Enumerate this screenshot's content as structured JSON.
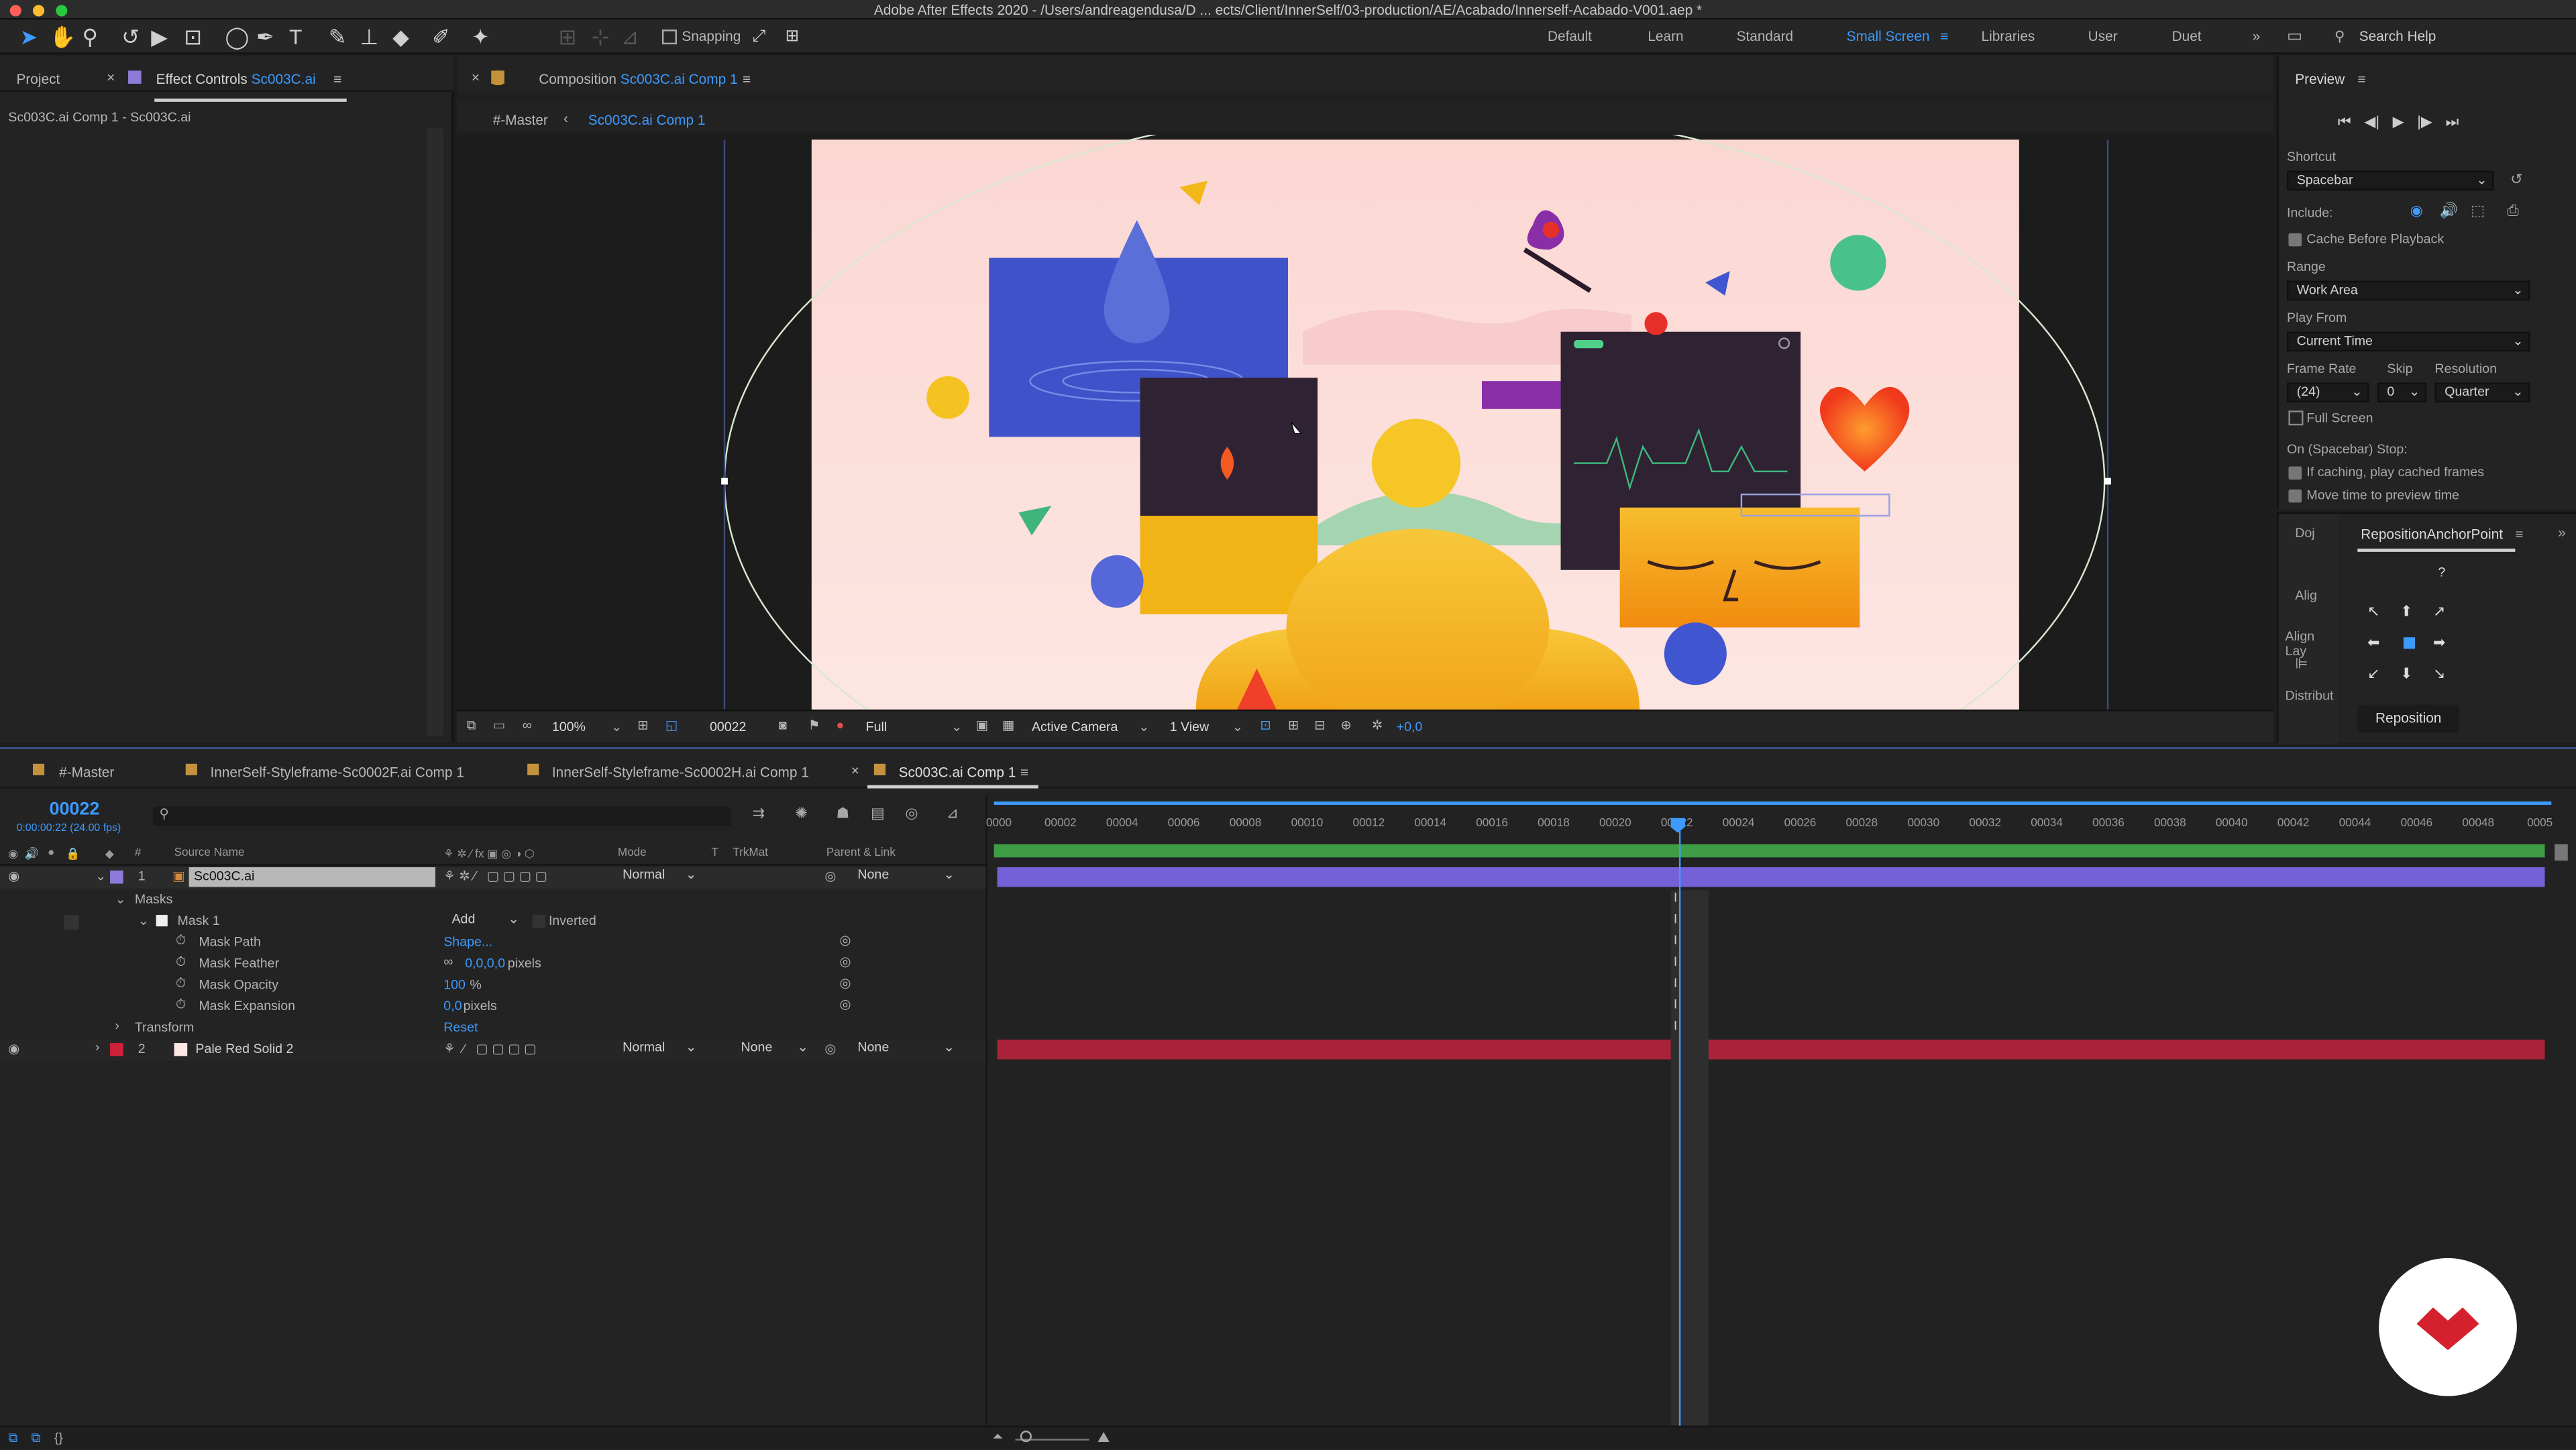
{
  "app": {
    "title": "Adobe After Effects 2020 - /Users/andreagendusa/D ... ects/Client/InnerSelf/03-production/AE/Acabado/Innerself-Acabado-V001.aep *"
  },
  "toolbar": {
    "snapping": "Snapping",
    "workspaces": [
      "Default",
      "Learn",
      "Standard",
      "Small Screen",
      "Libraries",
      "User",
      "Duet"
    ],
    "active_workspace": "Small Screen",
    "search_placeholder": "Search Help"
  },
  "left_panel": {
    "tab_project": "Project",
    "tab_effect_controls": "Effect Controls",
    "effect_target": "Sc003C.ai",
    "subtitle": "Sc003C.ai Comp 1 - Sc003C.ai"
  },
  "composition": {
    "tab_prefix": "Composition",
    "comp_name": "Sc003C.ai Comp 1",
    "breadcrumb_master": "#-Master",
    "breadcrumb_comp": "Sc003C.ai Comp 1",
    "zoom": "100%",
    "timecode": "00022",
    "resolution": "Full",
    "camera": "Active Camera",
    "views": "1 View",
    "exposure": "+0,0"
  },
  "preview": {
    "title": "Preview",
    "shortcut_label": "Shortcut",
    "shortcut_value": "Spacebar",
    "include_label": "Include:",
    "cache_label": "Cache Before Playback",
    "range_label": "Range",
    "range_value": "Work Area",
    "play_from_label": "Play From",
    "play_from_value": "Current Time",
    "frame_rate_label": "Frame Rate",
    "skip_label": "Skip",
    "resolution_label": "Resolution",
    "frame_rate_value": "(24)",
    "skip_value": "0",
    "resolution_value": "Quarter",
    "full_screen": "Full Screen",
    "on_stop_label": "On (Spacebar) Stop:",
    "if_caching": "If caching, play cached frames",
    "move_time": "Move time to preview time"
  },
  "reposition": {
    "tab_doj": "Doj",
    "tab_name": "RepositionAnchorPoint",
    "align_tab": "Alig",
    "align_layers": "Align Lay",
    "distribute": "Distribut",
    "help": "?",
    "button": "Reposition"
  },
  "timeline": {
    "tabs": [
      "#-Master",
      "InnerSelf-Styleframe-Sc0002F.ai Comp 1",
      "InnerSelf-Styleframe-Sc0002H.ai Comp 1",
      "Sc003C.ai Comp 1"
    ],
    "active_tab": "Sc003C.ai Comp 1",
    "timecode": "00022",
    "timecode_sub": "0:00:00:22 (24.00 fps)",
    "col_source_name": "Source Name",
    "col_mode": "Mode",
    "col_t": "T",
    "col_trkmat": "TrkMat",
    "col_parent": "Parent & Link",
    "ruler": [
      "0000",
      "00002",
      "00004",
      "00006",
      "00008",
      "00010",
      "00012",
      "00014",
      "00016",
      "00018",
      "00020",
      "00022",
      "00024",
      "00026",
      "00028",
      "00030",
      "00032",
      "00034",
      "00036",
      "00038",
      "00040",
      "00042",
      "00044",
      "00046",
      "00048",
      "0005"
    ],
    "layer1": {
      "num": "1",
      "name": "Sc003C.ai",
      "mode": "Normal",
      "parent": "None",
      "color": "#7b6ad6"
    },
    "masks_label": "Masks",
    "mask1": {
      "name": "Mask 1",
      "mode": "Add",
      "inverted": "Inverted"
    },
    "mask_props": [
      {
        "name": "Mask Path",
        "value": "Shape..."
      },
      {
        "name": "Mask Feather",
        "value": "0,0,0,0",
        "unit": " pixels"
      },
      {
        "name": "Mask Opacity",
        "value": "100",
        "unit": "%"
      },
      {
        "name": "Mask Expansion",
        "value": "0,0",
        "unit": " pixels"
      }
    ],
    "transform_label": "Transform",
    "transform_reset": "Reset",
    "layer2": {
      "num": "2",
      "name": "Pale Red Solid 2",
      "mode": "Normal",
      "trkmat": "None",
      "parent": "None",
      "color": "#d0213a"
    },
    "playhead_fraction": 0.44
  },
  "colors": {
    "accent": "#3d9aff",
    "layer1_bar": "#7461d8",
    "layer2_bar": "#a8233a",
    "workarea": "#3f9d45"
  }
}
